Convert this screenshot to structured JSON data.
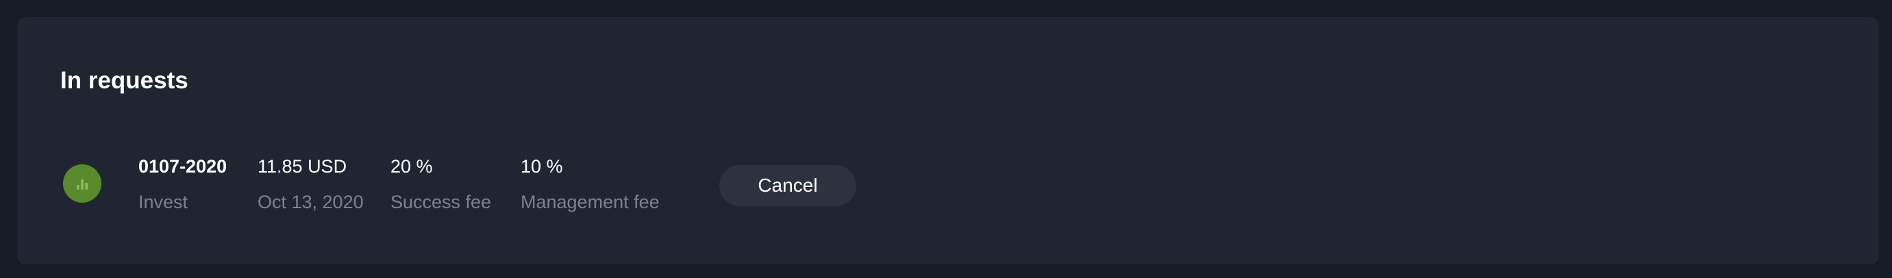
{
  "section": {
    "title": "In requests"
  },
  "requests": [
    {
      "icon": "bar-chart-icon",
      "icon_color": "#5a8a2e",
      "name": "0107-2020",
      "type": "Invest",
      "amount": "11.85 USD",
      "date": "Oct 13, 2020",
      "success_fee_value": "20 %",
      "success_fee_label": "Success fee",
      "management_fee_value": "10 %",
      "management_fee_label": "Management fee",
      "cancel_label": "Cancel"
    }
  ],
  "colors": {
    "background": "#161c25",
    "panel": "#1f2631",
    "button": "#2b333e",
    "muted_text": "#7b8391"
  }
}
